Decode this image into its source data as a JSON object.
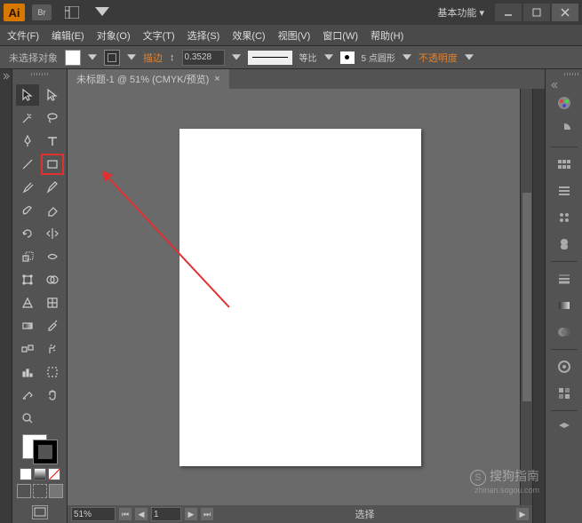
{
  "titlebar": {
    "br": "Br",
    "workspace": "基本功能"
  },
  "menu": {
    "file": "文件(F)",
    "edit": "编辑(E)",
    "object": "对象(O)",
    "text": "文字(T)",
    "select": "选择(S)",
    "effect": "效果(C)",
    "view": "视图(V)",
    "window": "窗口(W)",
    "help": "帮助(H)"
  },
  "optbar": {
    "noselect": "未选择对象",
    "stroke": "描边",
    "stroke_val": "0.3528",
    "profile": "等比",
    "brush_pt": "5 点圆形",
    "opacity": "不透明度"
  },
  "doc": {
    "title": "未标题-1 @ 51% (CMYK/预览)"
  },
  "status": {
    "zoom": "51%",
    "page": "1",
    "mode": "选择"
  },
  "watermark": {
    "brand": "搜狗指南",
    "url": "zhinan.sogou.com",
    "s": "S"
  }
}
